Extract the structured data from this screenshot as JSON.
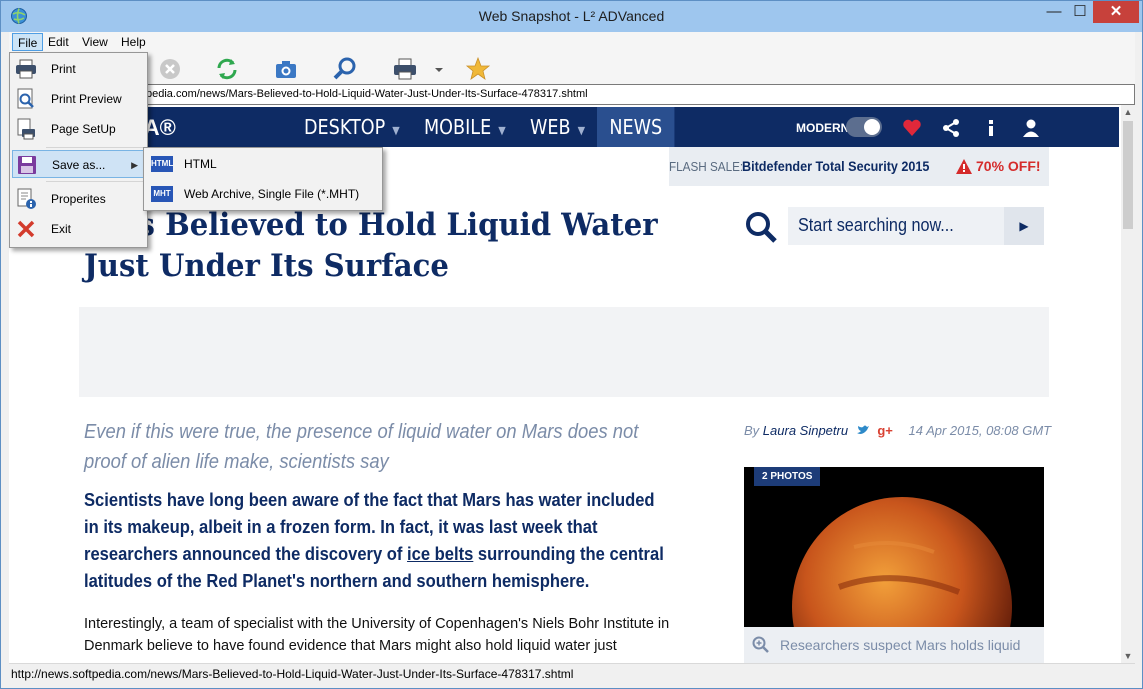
{
  "window": {
    "title": "Web Snapshot - L² ADVanced",
    "minimize": "—",
    "maximize": "☐",
    "close": "✕"
  },
  "menu": {
    "file": "File",
    "edit": "Edit",
    "view": "View",
    "help": "Help"
  },
  "toolbar": {
    "icons": [
      "print-icon",
      "stop-icon",
      "refresh-icon",
      "camera-icon",
      "zoom-icon",
      "printer-icon",
      "dropdown-icon",
      "favorite-icon"
    ]
  },
  "address": {
    "url": "pedia.com/news/Mars-Believed-to-Hold-Liquid-Water-Just-Under-Its-Surface-478317.shtml"
  },
  "file_menu": {
    "items": [
      {
        "label": "Print",
        "icon": "print-icon"
      },
      {
        "label": "Print Preview",
        "icon": "print-preview-icon"
      },
      {
        "label": "Page SetUp",
        "icon": "page-setup-icon"
      },
      {
        "label": "Save as...",
        "icon": "save-icon"
      },
      {
        "label": "Properites",
        "icon": "properties-icon"
      },
      {
        "label": "Exit",
        "icon": "exit-icon"
      }
    ]
  },
  "save_submenu": {
    "items": [
      {
        "label": "HTML",
        "badge": "HTML"
      },
      {
        "label": "Web Archive, Single File (*.MHT)",
        "badge": "MHT"
      }
    ]
  },
  "site": {
    "logo": "TPEDIA®",
    "nav": [
      "DESKTOP",
      "MOBILE",
      "WEB",
      "NEWS"
    ],
    "modern_label": "MODERN",
    "flash_label": "FLASH SALE:",
    "flash_product": "Bitdefender Total Security 2015",
    "flash_discount": "70% OFF!"
  },
  "article": {
    "headline_line1": "s Believed to Hold Liquid Water",
    "headline_line2": "Just Under Its Surface",
    "search_placeholder": "Start searching now...",
    "subtitle": "Even if this were true, the presence of liquid water on Mars does not proof of alien life make, scientists say",
    "lead_part1": "Scientists have long been aware of the fact that Mars has water included in its makeup, albeit in a frozen form. In fact, it was last week that researchers announced the discovery of ",
    "lead_link": "ice belts",
    "lead_part2": " surrounding the central latitudes of the Red Planet's northern and southern hemisphere.",
    "body": "Interestingly, a team of specialist with the University of Copenhagen's Niels Bohr Institute in Denmark believe to have found evidence that Mars might also hold liquid water just",
    "byline_prefix": "By",
    "author": "Laura Sinpetru",
    "date": "14 Apr 2015, 08:08 GMT",
    "photo_badge": "2 PHOTOS",
    "caption": "Researchers suspect Mars holds liquid water"
  },
  "status": {
    "text": "http://news.softpedia.com/news/Mars-Believed-to-Hold-Liquid-Water-Just-Under-Its-Surface-478317.shtml"
  },
  "colors": {
    "navy": "#0e2b64",
    "titlebar": "#9ec6ee",
    "close": "#c7413b",
    "sale_red": "#d52b2b"
  }
}
